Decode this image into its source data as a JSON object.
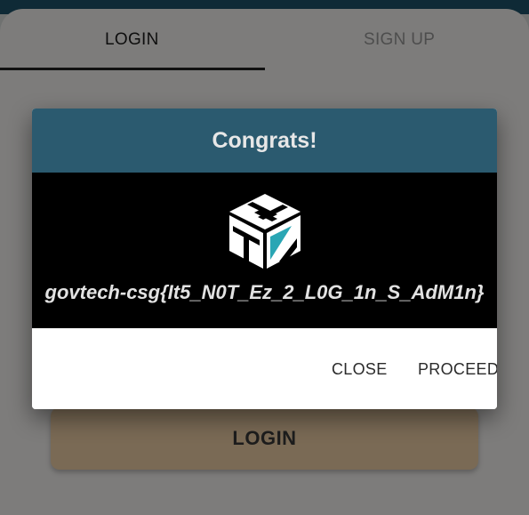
{
  "tabs": {
    "login": "LOGIN",
    "signup": "SIGN UP"
  },
  "login_button": "LOGIN",
  "dialog": {
    "title": "Congrats!",
    "flag": "govtech-csg{It5_N0T_Ez_2_L0G_1n_S_AdM1n}",
    "logo_icon": "stack-logo-icon",
    "close_label": "CLOSE",
    "proceed_label": "PROCEED"
  },
  "colors": {
    "dialog_header": "#2b5a6f",
    "overlay": "#7d7c7b",
    "login_button": "#7a6a55",
    "logo_accent": "#2aa6b4"
  }
}
